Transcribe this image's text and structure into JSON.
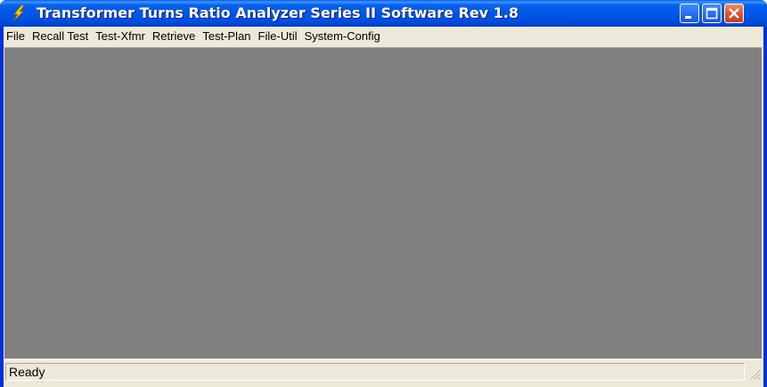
{
  "window": {
    "title": "Transformer Turns Ratio Analyzer Series II Software Rev 1.8",
    "icon": "lightning-bolt-icon",
    "controls": {
      "minimize_icon": "minimize-icon",
      "maximize_icon": "maximize-icon",
      "close_icon": "close-icon"
    }
  },
  "menubar": {
    "items": [
      {
        "label": "File"
      },
      {
        "label": "Recall Test"
      },
      {
        "label": "Test-Xfmr"
      },
      {
        "label": "Retrieve"
      },
      {
        "label": "Test-Plan"
      },
      {
        "label": "File-Util"
      },
      {
        "label": "System-Config"
      }
    ]
  },
  "statusbar": {
    "text": "Ready"
  },
  "colors": {
    "titlebar": "#0058e6",
    "workspace": "#808080",
    "chrome": "#ece9d8",
    "close_button": "#e2522b"
  }
}
